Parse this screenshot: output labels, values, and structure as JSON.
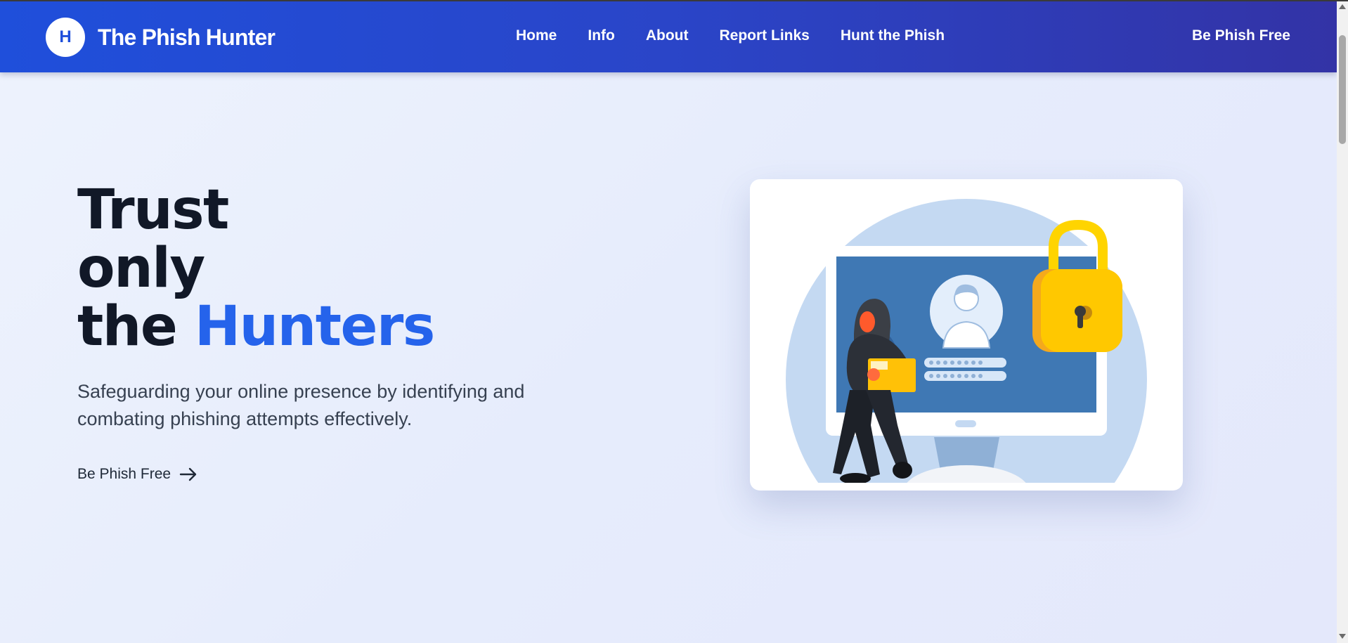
{
  "header": {
    "logo_letter": "H",
    "brand": "The Phish Hunter",
    "nav": [
      "Home",
      "Info",
      "About",
      "Report Links",
      "Hunt the Phish"
    ],
    "cta": "Be Phish Free"
  },
  "hero": {
    "headline_line1": "Trust",
    "headline_line2": "only",
    "headline_line3_prefix": "the",
    "headline_line3_accent": "Hunters",
    "subtitle": "Safeguarding your online presence by identifying and combating phishing attempts effectively.",
    "cta": "Be Phish Free"
  },
  "colors": {
    "brand_blue": "#1f4fdb",
    "header_end": "#3333a6",
    "accent": "#2563eb",
    "text_dark": "#111827",
    "lock_yellow": "#ffc800"
  },
  "icons": {
    "cta_arrow": "arrow-right-icon",
    "illustration": "hacker-lock-computer-illustration"
  }
}
